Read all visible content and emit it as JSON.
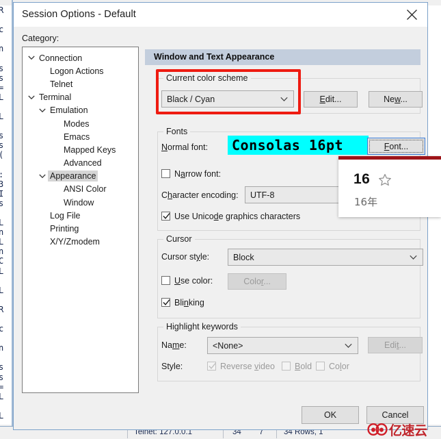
{
  "background": {
    "terminal_left_text": "R\n \nc\n \nn\n \ns\ns\n=\nL\n \nL\n \ns\ns\n(\n \n:\n3\nI\ns\n \nL\nn\nL\nn\nC\nL\n \nL\n ",
    "statusbar": {
      "connection": "Telnet: 127.0.0.1",
      "col": "34",
      "row": "7",
      "size": "34 Rows, 1"
    },
    "watermark_text": "亿速云"
  },
  "dialog": {
    "title": "Session Options - Default",
    "close_icon": "close-icon",
    "category_label": "Category:",
    "tree": [
      {
        "label": "Connection",
        "indent": 0,
        "chevron": true,
        "selected": false
      },
      {
        "label": "Logon Actions",
        "indent": 1,
        "chevron": false,
        "selected": false
      },
      {
        "label": "Telnet",
        "indent": 1,
        "chevron": false,
        "selected": false
      },
      {
        "label": "Terminal",
        "indent": 0,
        "chevron": true,
        "selected": false
      },
      {
        "label": "Emulation",
        "indent": 1,
        "chevron": true,
        "selected": false
      },
      {
        "label": "Modes",
        "indent": 2,
        "chevron": false,
        "selected": false
      },
      {
        "label": "Emacs",
        "indent": 2,
        "chevron": false,
        "selected": false
      },
      {
        "label": "Mapped Keys",
        "indent": 2,
        "chevron": false,
        "selected": false
      },
      {
        "label": "Advanced",
        "indent": 2,
        "chevron": false,
        "selected": false
      },
      {
        "label": "Appearance",
        "indent": 1,
        "chevron": true,
        "selected": true
      },
      {
        "label": "ANSI Color",
        "indent": 2,
        "chevron": false,
        "selected": false
      },
      {
        "label": "Window",
        "indent": 2,
        "chevron": false,
        "selected": false
      },
      {
        "label": "Log File",
        "indent": 1,
        "chevron": false,
        "selected": false
      },
      {
        "label": "Printing",
        "indent": 1,
        "chevron": false,
        "selected": false
      },
      {
        "label": "X/Y/Zmodem",
        "indent": 1,
        "chevron": false,
        "selected": false
      }
    ],
    "panel_header": "Window and Text Appearance",
    "color_scheme": {
      "group_label": "Current color scheme",
      "value": "Black / Cyan",
      "edit_button": "Edit...",
      "new_button": "New...",
      "annotation_color": "#ee1b11"
    },
    "fonts": {
      "group_label": "Fonts",
      "normal_font_label": "Normal font:",
      "normal_font_value": "Consolas 16pt",
      "normal_font_bg": "#00ffff",
      "font_button": "Font...",
      "narrow_font_label": "Narrow font:",
      "narrow_font_checked": false,
      "char_encoding_label": "Character encoding:",
      "char_encoding_value": "UTF-8",
      "unicode_graphics_label": "Use Unicode graphics characters",
      "unicode_graphics_checked": true
    },
    "cursor": {
      "group_label": "Cursor",
      "style_label": "Cursor style:",
      "style_value": "Block",
      "use_color_label": "Use color:",
      "use_color_checked": false,
      "color_button": "Color...",
      "blinking_label": "Blinking",
      "blinking_checked": true
    },
    "highlight": {
      "group_label": "Highlight keywords",
      "name_label": "Name:",
      "name_value": "<None>",
      "edit_button": "Edit...",
      "style_label": "Style:",
      "reverse_video_label": "Reverse video",
      "reverse_video_checked": true,
      "bold_label": "Bold",
      "bold_checked": false,
      "color_label": "Color",
      "color_checked": false
    },
    "ok_button": "OK",
    "cancel_button": "Cancel"
  },
  "ime_popup": {
    "candidate": "16",
    "reading": "16年",
    "star_icon": "star-outline-icon",
    "accent": "#9e1419"
  }
}
